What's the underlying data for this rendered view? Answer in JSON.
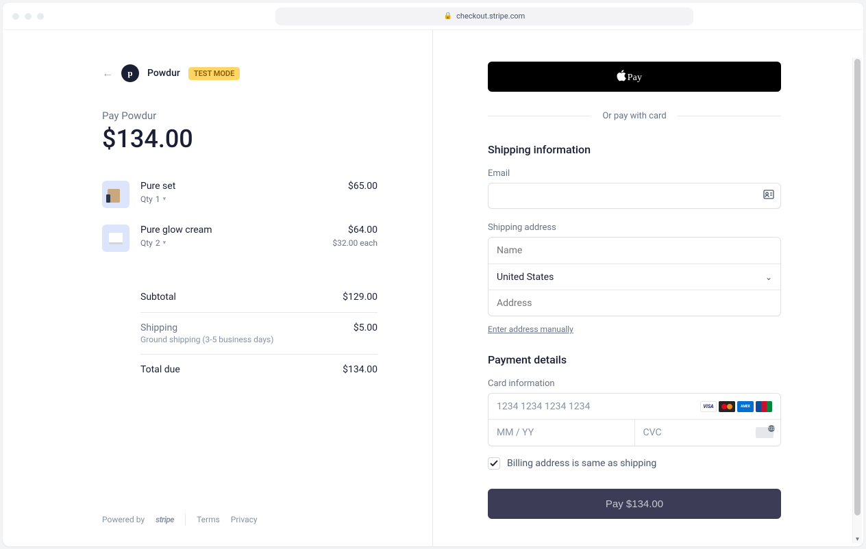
{
  "browser": {
    "url": "checkout.stripe.com"
  },
  "merchant": {
    "name": "Powdur",
    "logo_letter": "p",
    "test_mode": "TEST MODE"
  },
  "summary": {
    "pay_label": "Pay Powdur",
    "amount": "$134.00",
    "subtotal_label": "Subtotal",
    "subtotal": "$129.00",
    "shipping_label": "Shipping",
    "shipping_sublabel": "Ground shipping (3-5 business days)",
    "shipping": "$5.00",
    "total_label": "Total due",
    "total": "$134.00"
  },
  "items": [
    {
      "name": "Pure set",
      "qty_label": "Qty",
      "qty": "1",
      "price": "$65.00",
      "each": ""
    },
    {
      "name": "Pure glow cream",
      "qty_label": "Qty",
      "qty": "2",
      "price": "$64.00",
      "each": "$32.00 each"
    }
  ],
  "footer": {
    "powered": "Powered by",
    "stripe": "stripe",
    "terms": "Terms",
    "privacy": "Privacy"
  },
  "right": {
    "apple_pay": "Pay",
    "or_text": "Or pay with card",
    "shipping_heading": "Shipping information",
    "email_label": "Email",
    "shipping_address_label": "Shipping address",
    "name_placeholder": "Name",
    "country": "United States",
    "address_placeholder": "Address",
    "manual_link": "Enter address manually",
    "payment_heading": "Payment details",
    "card_info_label": "Card information",
    "card_number_placeholder": "1234 1234 1234 1234",
    "expiry_placeholder": "MM / YY",
    "cvc_placeholder": "CVC",
    "billing_same": "Billing address is same as shipping",
    "pay_button": "Pay $134.00"
  }
}
